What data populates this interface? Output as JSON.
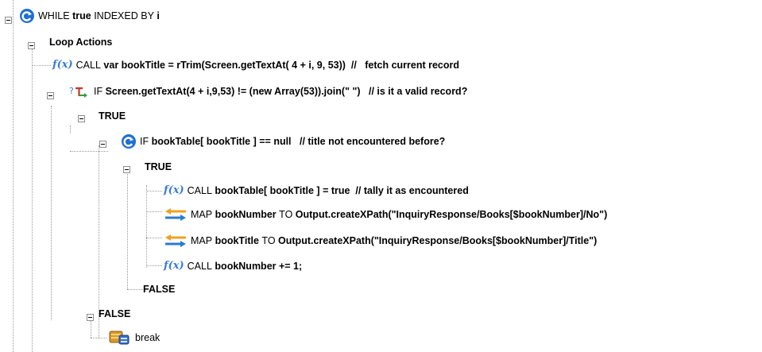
{
  "tree": {
    "while_node": {
      "keyword": "WHILE",
      "condition": "true",
      "indexed_by": "INDEXED BY",
      "index": "i"
    },
    "loop_actions": {
      "label": "Loop Actions"
    },
    "call_book_title": {
      "keyword": "CALL",
      "code": "var bookTitle = rTrim(Screen.getTextAt( 4 + i, 9, 53))",
      "comment": "//   fetch current record"
    },
    "if_valid_record": {
      "keyword": "IF",
      "code": "Screen.getTextAt(4 + i,9,53) != (new Array(53)).join(\" \")",
      "comment": "// is it a valid record?"
    },
    "true_branch_1": {
      "label": "TRUE"
    },
    "if_not_encountered": {
      "keyword": "IF",
      "code": "bookTable[ bookTitle ] == null",
      "comment": "// title not encountered before?"
    },
    "true_branch_2": {
      "label": "TRUE"
    },
    "call_tally": {
      "keyword": "CALL",
      "code": "bookTable[ bookTitle ] = true",
      "comment": "// tally it as encountered"
    },
    "map_book_number": {
      "keyword": "MAP",
      "source": "bookNumber",
      "to": "TO",
      "target": "Output.createXPath(\"InquiryResponse/Books[$bookNumber]/No\")"
    },
    "map_book_title": {
      "keyword": "MAP",
      "source": "bookTitle",
      "to": "TO",
      "target": "Output.createXPath(\"InquiryResponse/Books[$bookNumber]/Title\")"
    },
    "call_increment": {
      "keyword": "CALL",
      "code": "bookNumber += 1;"
    },
    "false_branch_2": {
      "label": "FALSE"
    },
    "false_branch_1": {
      "label": "FALSE"
    },
    "break_node": {
      "label": "break"
    }
  },
  "icons": {
    "loop": "loop-icon",
    "function": "function-icon",
    "function_glyph": "f(x)",
    "conditional": "conditional-icon",
    "conditional_glyph": "?",
    "map": "map-arrows-icon",
    "break": "break-icon"
  },
  "colors": {
    "accent_blue": "#1f6fd1",
    "fx_blue": "#3a7bd5",
    "map_orange": "#f0a020",
    "tree_line": "#9a9a9a"
  }
}
